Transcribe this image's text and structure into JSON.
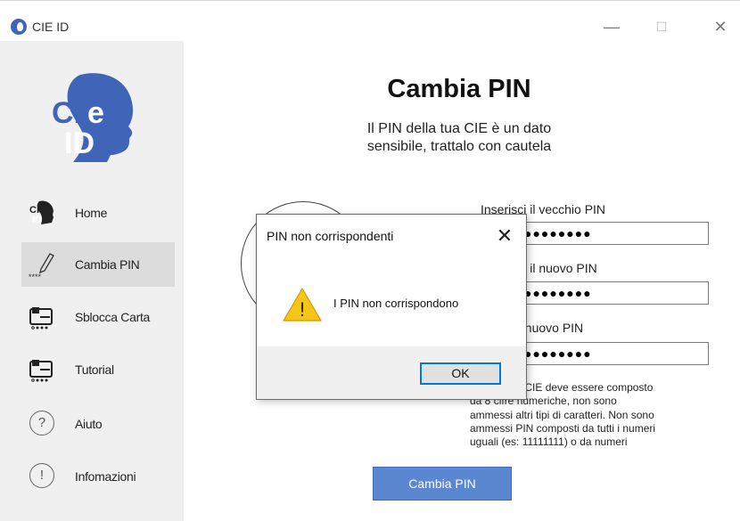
{
  "window": {
    "title": "CIE ID",
    "minimize": "—",
    "maximize": "☐",
    "close": "✕"
  },
  "sidebar": {
    "items": [
      {
        "label": "Home",
        "icon": "cie-id-icon",
        "active": false
      },
      {
        "label": "Cambia PIN",
        "icon": "pencil-pin-icon",
        "active": true
      },
      {
        "label": "Sblocca Carta",
        "icon": "card-unlock-icon",
        "active": false
      },
      {
        "label": "Tutorial",
        "icon": "card-tutorial-icon",
        "active": false
      },
      {
        "label": "Aiuto",
        "icon": "question-icon",
        "symbol": "?",
        "active": false
      },
      {
        "label": "Infomazioni",
        "icon": "info-icon",
        "symbol": "!",
        "active": false
      }
    ]
  },
  "main": {
    "title": "Cambia PIN",
    "subtitle_line1": "Il PIN della tua CIE è un dato",
    "subtitle_line2": "sensibile,  trattalo con cautela",
    "fields": [
      {
        "label": "Inserisci il vecchio PIN",
        "value": "●●●●●●●●"
      },
      {
        "label": "Inserisci il nuovo PIN",
        "value": "●●●●●●●●"
      },
      {
        "label": "Ripeti il nuovo PIN",
        "value": "●●●●●●●●"
      }
    ],
    "info_lines": [
      "Il PIN della CIE deve essere composto",
      "da 8 cifre numeriche, non sono",
      "ammessi altri tipi di caratteri. Non sono",
      "ammessi PIN composti da tutti i numeri",
      "uguali (es: 11111111) o da numeri"
    ],
    "button_label": "Cambia PIN"
  },
  "dialog": {
    "title": "PIN non corrispondenti",
    "close": "✕",
    "message": "I PIN non corrispondono",
    "ok_label": "OK",
    "warning_symbol": "!"
  },
  "colors": {
    "accent": "#5b87d0",
    "brand": "#3f64b8",
    "warning": "#f5c518",
    "focus": "#0078d7"
  }
}
